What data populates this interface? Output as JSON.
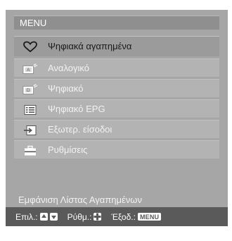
{
  "menu": {
    "title": "MENU",
    "items": [
      {
        "icon": "heart-icon",
        "label": "Ψηφιακά αγαπημένα",
        "selected": true
      },
      {
        "icon": "analog-tv-icon",
        "label": "Αναλογικό",
        "selected": false
      },
      {
        "icon": "digital-tv-icon",
        "label": "Ψηφιακό",
        "selected": false
      },
      {
        "icon": "epg-list-icon",
        "label": "Ψηφιακό EPG",
        "selected": false
      },
      {
        "icon": "external-input-icon",
        "label": "Εξωτερ. είσοδοι",
        "selected": false
      },
      {
        "icon": "toolbox-icon",
        "label": "Ρυθμίσεις",
        "selected": false
      }
    ],
    "info_text": "Εμφάνιση Λίστας Αγαπημένων"
  },
  "footer": {
    "select_label": "Επιλ.:",
    "adjust_label": "Ρύθμ.:",
    "exit_label": "Έξοδ.:",
    "exit_key": "MENU"
  },
  "colors": {
    "panel": "#a6a6a6",
    "item": "#b3b3b3",
    "selected_item": "#9b9b9b",
    "footer": "#5a5a5a"
  }
}
